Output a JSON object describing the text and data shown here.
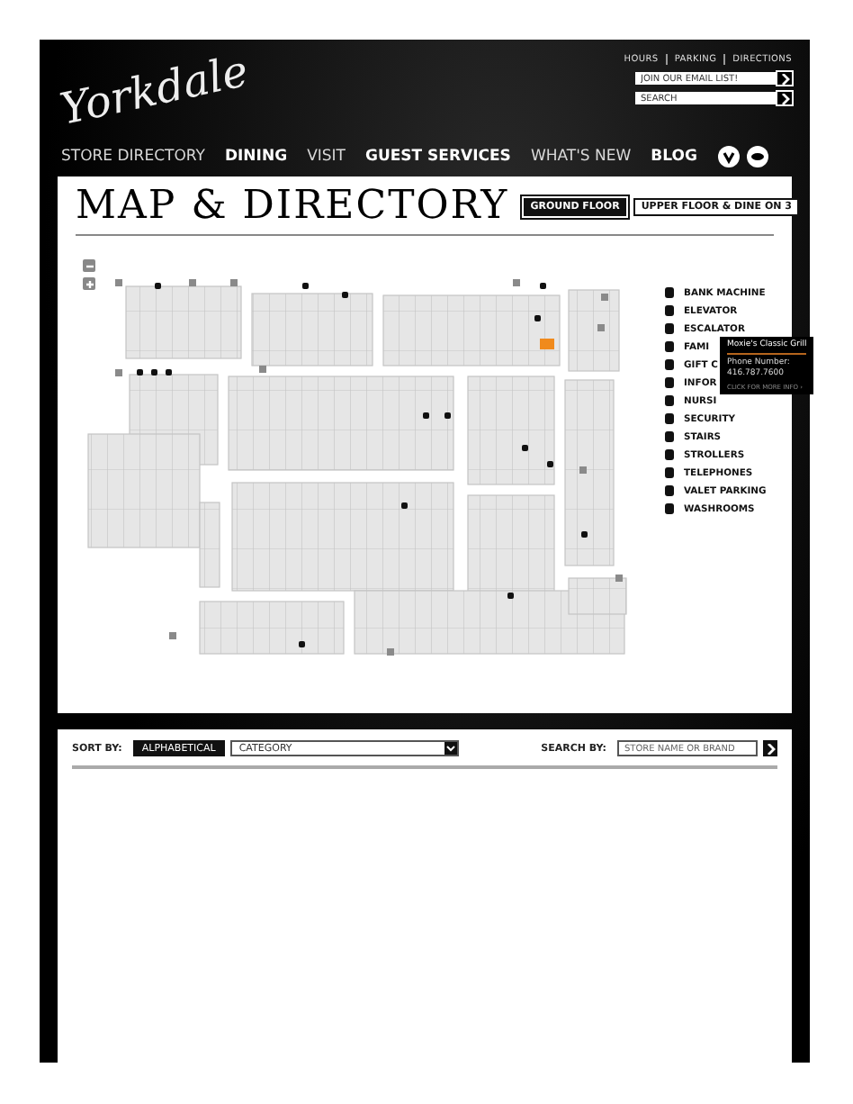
{
  "logo": "Yorkdale",
  "top_links": [
    "HOURS",
    "PARKING",
    "DIRECTIONS"
  ],
  "header_fields": [
    {
      "placeholder": "JOIN OUR EMAIL LIST!"
    },
    {
      "placeholder": "SEARCH"
    }
  ],
  "nav": [
    {
      "label": "STORE DIRECTORY",
      "bold": false
    },
    {
      "label": "DINING",
      "bold": true
    },
    {
      "label": "VISIT",
      "bold": false
    },
    {
      "label": "GUEST SERVICES",
      "bold": true
    },
    {
      "label": "WHAT'S NEW",
      "bold": false
    },
    {
      "label": "BLOG",
      "bold": true
    }
  ],
  "page_title": "MAP & DIRECTORY",
  "floor_tabs": [
    {
      "label": "GROUND FLOOR",
      "selected": true
    },
    {
      "label": "UPPER FLOOR & DINE ON 3",
      "selected": false
    }
  ],
  "legend": [
    "BANK MACHINE",
    "ELEVATOR",
    "ESCALATOR",
    "FAMI",
    "GIFT C",
    "INFOR",
    "NURSI",
    "SECURITY",
    "STAIRS",
    "STROLLERS",
    "TELEPHONES",
    "VALET PARKING",
    "WASHROOMS"
  ],
  "tooltip": {
    "name": "Moxie's Classic Grill",
    "phone_label": "Phone Number:",
    "phone": "416.787.7600",
    "link": "CLICK FOR MORE INFO ›"
  },
  "sort": {
    "label": "SORT BY:",
    "options": [
      {
        "label": "ALPHABETICAL",
        "selected": true
      },
      {
        "label": "CATEGORY",
        "selected": false
      }
    ]
  },
  "search_by": {
    "label": "SEARCH BY:",
    "placeholder": "STORE NAME OR BRAND"
  }
}
